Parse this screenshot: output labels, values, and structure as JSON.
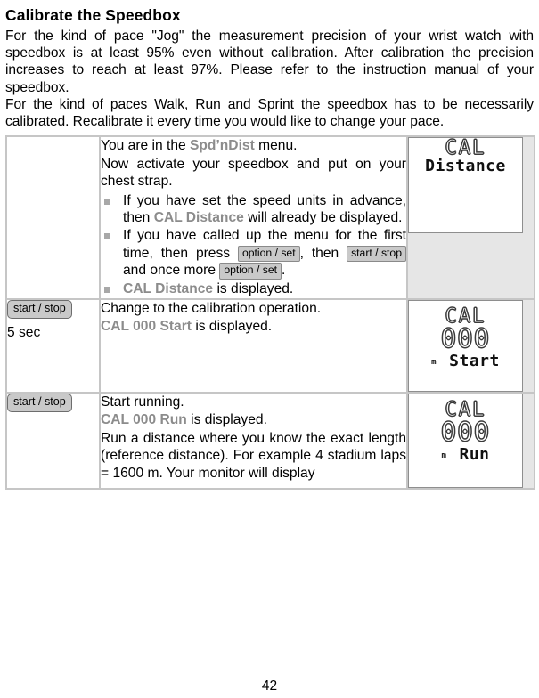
{
  "document": {
    "title": "Calibrate the Speedbox",
    "intro_paragraphs": [
      "For the kind of pace \"Jog\" the measurement precision of your wrist watch with speedbox is at least 95% even without calibration. After calibration the precision increases to reach at least 97%. Please refer to the instruction manual of your speedbox.",
      "For the kind of paces Walk, Run and Sprint the speedbox has to be necessarily calibrated. Recalibrate it every time you would like to change your pace."
    ],
    "page_number": "42"
  },
  "colors": {
    "lcd_term": "#8c8c8c",
    "key_bg": "#c9c9c9",
    "table_border": "#c6c6c6",
    "lcd_column_bg": "#e6e6e6",
    "bullet": "#a8a8a8"
  },
  "table": {
    "rows": [
      {
        "key": {
          "button": "",
          "duration": ""
        },
        "description": {
          "line1_pre": "You are in the ",
          "line1_term": "Spd’nDist",
          "line1_post": " menu.",
          "line2": "Now activate your speedbox and put on your chest strap.",
          "bullets": [
            {
              "pre": "If you have set the speed units in advance, then ",
              "term": "CAL Distance",
              "post": " will already be displayed."
            },
            {
              "pre": "If you have called up the menu for the first time, then press ",
              "key1": "option / set",
              "mid1": ", then ",
              "key2": "start / stop",
              "mid2": " and once more ",
              "key3": "option / set",
              "post": "."
            },
            {
              "term": "CAL Distance",
              "post": " is displayed."
            }
          ]
        },
        "lcd": {
          "seg_line": "CAL",
          "numeric": "",
          "unit": "",
          "word": "Distance"
        }
      },
      {
        "key": {
          "button": "start / stop",
          "duration": "5 sec"
        },
        "description": {
          "line1": "Change to the calibration operation.",
          "line2_term": "CAL 000 Start",
          "line2_post": " is displayed."
        },
        "lcd": {
          "seg_line": "CAL",
          "numeric": "000",
          "unit": "m",
          "word": "Start"
        }
      },
      {
        "key": {
          "button": "start / stop",
          "duration": ""
        },
        "description": {
          "line1": "Start running.",
          "line2_term": "CAL 000 Run",
          "line2_post": " is displayed.",
          "line3": "Run a distance where you know the exact length (reference distance). For example 4 stadium laps = 1600 m. Your monitor will display"
        },
        "lcd": {
          "seg_line": "CAL",
          "numeric": "000",
          "unit": "m",
          "word": "Run"
        }
      }
    ]
  }
}
